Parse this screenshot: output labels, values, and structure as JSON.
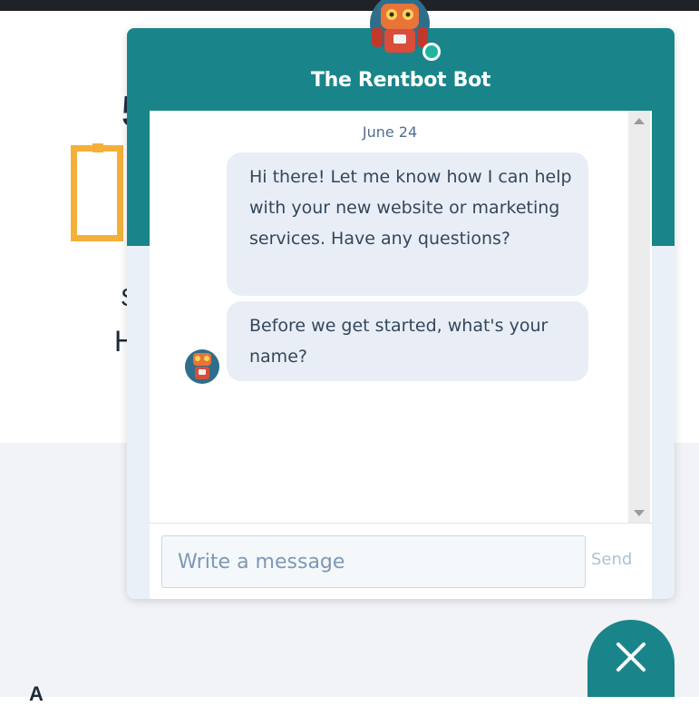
{
  "chat": {
    "title": "The Rentbot Bot",
    "date": "June 24",
    "messages": [
      "Hi there! Let me know how I can help with your new website or marketing services. Have any questions?",
      "Before we get started, what's your name?"
    ],
    "input_placeholder": "Write a message",
    "send_label": "Send",
    "bot_online": true
  },
  "colors": {
    "header": "#19858a",
    "bubble": "#e9eef6",
    "background_accent": "#f5b03a"
  },
  "icons": {
    "bot_avatar": "robot-avatar-icon",
    "close": "close-icon",
    "scroll_up": "scroll-up-arrow-icon",
    "scroll_down": "scroll-down-arrow-icon"
  }
}
